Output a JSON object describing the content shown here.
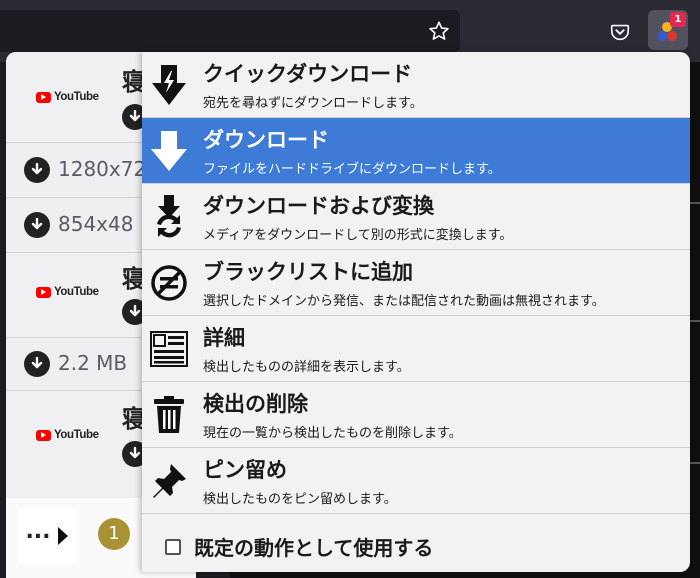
{
  "menu": {
    "items": [
      {
        "id": "quick-download",
        "title": "クイックダウンロード",
        "desc": "宛先を尋ねずにダウンロードします。"
      },
      {
        "id": "download",
        "title": "ダウンロード",
        "desc": "ファイルをハードドライブにダウンロードします。"
      },
      {
        "id": "download-convert",
        "title": "ダウンロードおよび変換",
        "desc": "メディアをダウンロードして別の形式に変換します。"
      },
      {
        "id": "add-blacklist",
        "title": "ブラックリストに追加",
        "desc": "選択したドメインから発信、または配信された動画は無視されます。"
      },
      {
        "id": "details",
        "title": "詳細",
        "desc": "検出したものの詳細を表示します。"
      },
      {
        "id": "delete-detection",
        "title": "検出の削除",
        "desc": "現在の一覧から検出したものを削除します。"
      },
      {
        "id": "pin",
        "title": "ピン留め",
        "desc": "検出したものをピン留めします。"
      }
    ],
    "active_index": 1,
    "default_action_label": "既定の動作として使用する",
    "default_action_checked": false
  },
  "hits": {
    "youtube_label": "YouTube",
    "title_fragment": "寝",
    "sizes": [
      "1280x72",
      "854x48",
      "2.2 MB"
    ]
  },
  "popup": {
    "more_label": "...",
    "hit_count": "1"
  },
  "toolbar": {
    "extension_badge": "1"
  },
  "colors": {
    "active": "#3d7bd6",
    "youtube_red": "#ff0000",
    "badge_red": "#e22850",
    "count_badge": "#a99234"
  }
}
